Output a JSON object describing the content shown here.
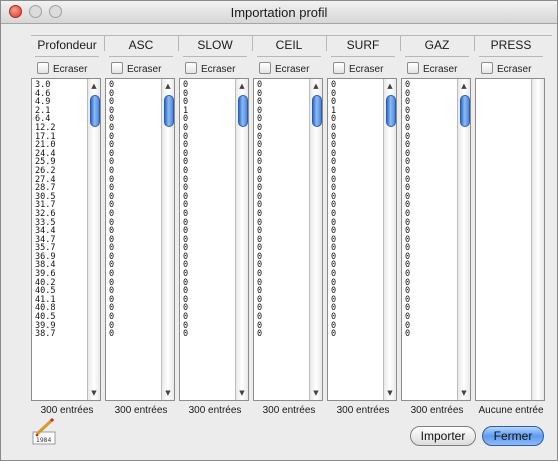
{
  "window": {
    "title": "Importation profil"
  },
  "columns": [
    {
      "name": "Profondeur",
      "checkbox_label": "Ecraser",
      "footer": "300 entrées",
      "values": [
        "3.0",
        "4.6",
        "4.9",
        "2.1",
        "6.4",
        "12.2",
        "17.1",
        "21.0",
        "24.4",
        "25.9",
        "26.2",
        "27.4",
        "28.7",
        "30.5",
        "31.7",
        "32.6",
        "33.5",
        "34.4",
        "34.7",
        "35.7",
        "36.9",
        "38.4",
        "39.6",
        "40.2",
        "40.5",
        "41.1",
        "40.8",
        "40.5",
        "39.9",
        "38.7"
      ]
    },
    {
      "name": "ASC",
      "checkbox_label": "Ecraser",
      "footer": "300 entrées",
      "values": [
        "0",
        "0",
        "0",
        "0",
        "0",
        "0",
        "0",
        "0",
        "0",
        "0",
        "0",
        "0",
        "0",
        "0",
        "0",
        "0",
        "0",
        "0",
        "0",
        "0",
        "0",
        "0",
        "0",
        "0",
        "0",
        "0",
        "0",
        "0",
        "0",
        "0"
      ]
    },
    {
      "name": "SLOW",
      "checkbox_label": "Ecraser",
      "footer": "300 entrées",
      "values": [
        "0",
        "0",
        "0",
        "1",
        "0",
        "0",
        "0",
        "0",
        "0",
        "0",
        "0",
        "0",
        "0",
        "0",
        "0",
        "0",
        "0",
        "0",
        "0",
        "0",
        "0",
        "0",
        "0",
        "0",
        "0",
        "0",
        "0",
        "0",
        "0",
        "0"
      ]
    },
    {
      "name": "CEIL",
      "checkbox_label": "Ecraser",
      "footer": "300 entrées",
      "values": [
        "0",
        "0",
        "0",
        "0",
        "0",
        "0",
        "0",
        "0",
        "0",
        "0",
        "0",
        "0",
        "0",
        "0",
        "0",
        "0",
        "0",
        "0",
        "0",
        "0",
        "0",
        "0",
        "0",
        "0",
        "0",
        "0",
        "0",
        "0",
        "0",
        "0"
      ]
    },
    {
      "name": "SURF",
      "checkbox_label": "Ecraser",
      "footer": "300 entrées",
      "values": [
        "0",
        "0",
        "0",
        "1",
        "0",
        "0",
        "0",
        "0",
        "0",
        "0",
        "0",
        "0",
        "0",
        "0",
        "0",
        "0",
        "0",
        "0",
        "0",
        "0",
        "0",
        "0",
        "0",
        "0",
        "0",
        "0",
        "0",
        "0",
        "0",
        "0"
      ]
    },
    {
      "name": "GAZ",
      "checkbox_label": "Ecraser",
      "footer": "300 entrées",
      "values": [
        "0",
        "0",
        "0",
        "0",
        "0",
        "0",
        "0",
        "0",
        "0",
        "0",
        "0",
        "0",
        "0",
        "0",
        "0",
        "0",
        "0",
        "0",
        "0",
        "0",
        "0",
        "0",
        "0",
        "0",
        "0",
        "0",
        "0",
        "0",
        "0",
        "0"
      ]
    },
    {
      "name": "PRESS",
      "checkbox_label": "Ecraser",
      "footer": "Aucune entrée",
      "values": []
    }
  ],
  "buttons": {
    "import_label": "Importer",
    "close_label": "Fermer"
  },
  "app_icon": {
    "name": "1984-icon",
    "text": "1984"
  },
  "colors": {
    "accent": "#5e9bf0",
    "scroll_thumb": "#2f6fc9"
  }
}
